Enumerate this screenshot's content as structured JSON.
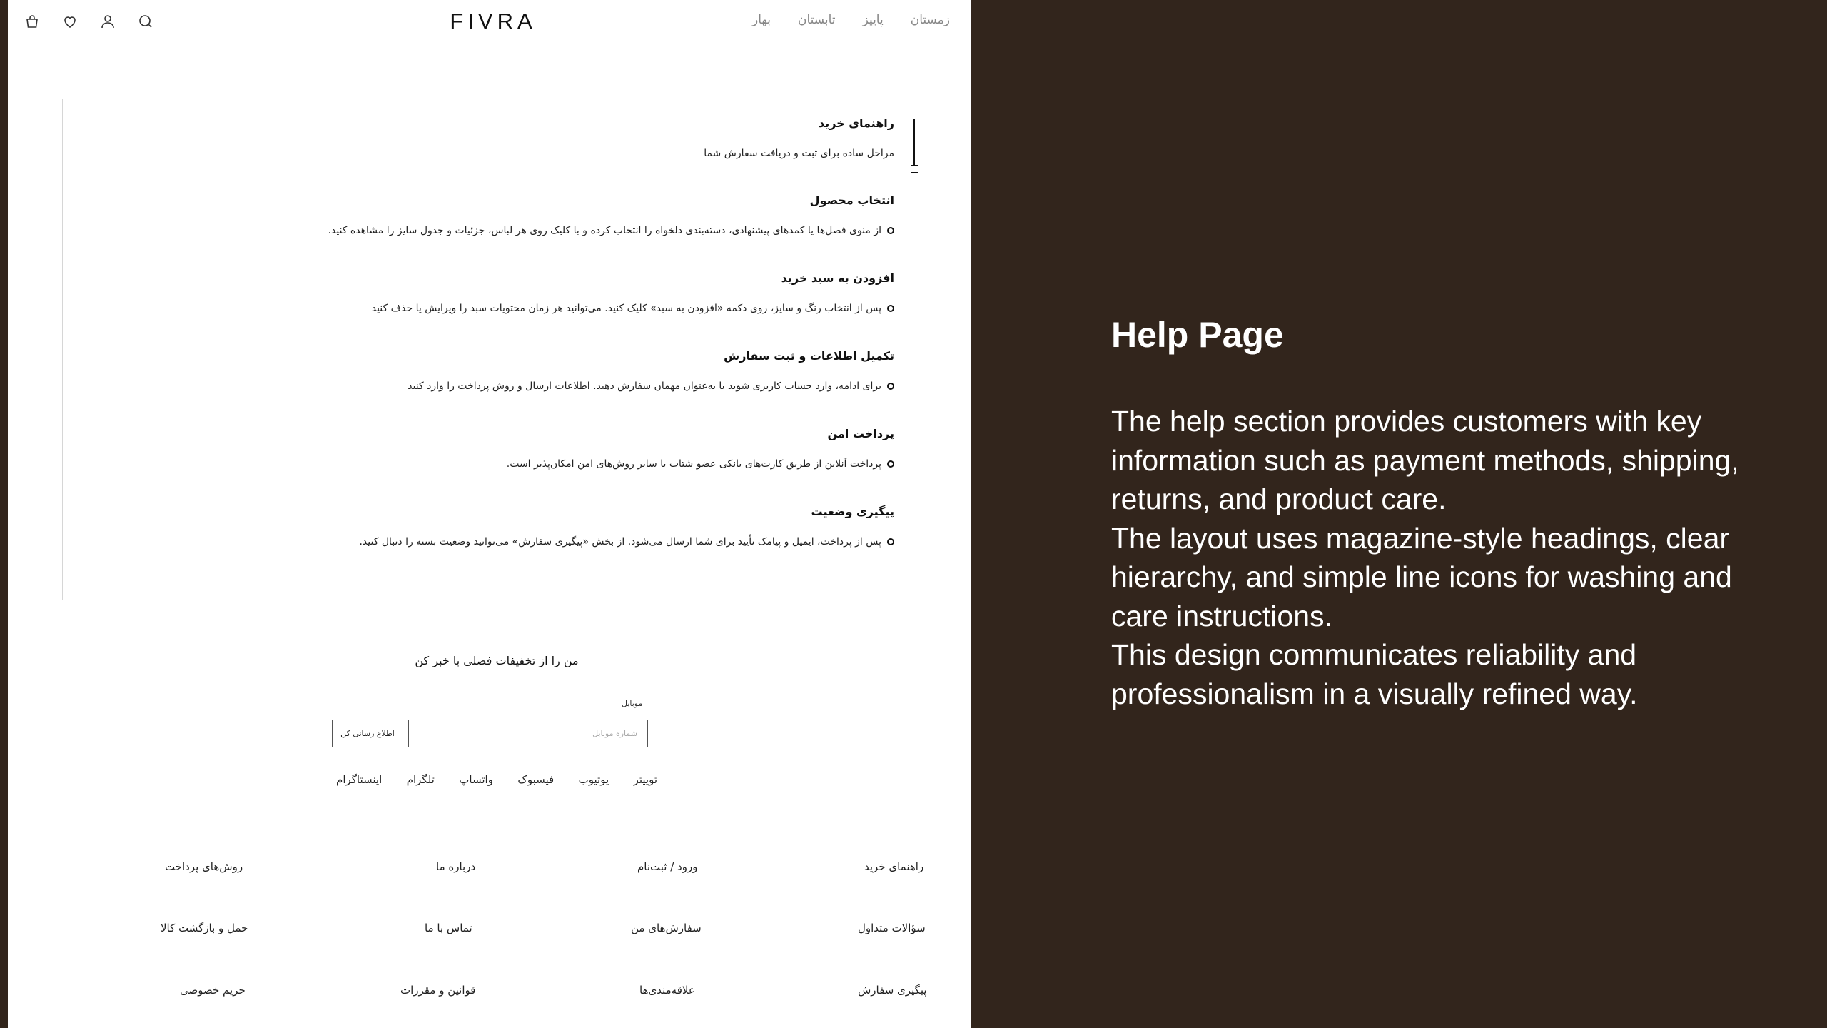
{
  "header": {
    "logo": "FIVRA",
    "nav": [
      "بهار",
      "تابستان",
      "پاییز",
      "زمستان"
    ],
    "icons": [
      "search-icon",
      "user-icon",
      "heart-icon",
      "bag-icon"
    ]
  },
  "guide": {
    "title": "راهنمای خرید",
    "subtitle": "مراحل ساده برای ثبت و دریافت سفارش شما",
    "steps": [
      {
        "title": "انتخاب محصول",
        "text": "از منوی فصل‌ها یا کمدهای پیشنهادی، دسته‌بندی دلخواه را انتخاب کرده و با کلیک روی هر لباس، جزئیات و جدول سایز را مشاهده کنید."
      },
      {
        "title": "افزودن به سبد خرید",
        "text": "پس از انتخاب رنگ و سایز، روی دکمه «افزودن به سبد» کلیک کنید. می‌توانید هر زمان محتویات سبد را ویرایش یا حذف کنید"
      },
      {
        "title": "تکمیل اطلاعات و ثبت سفارش",
        "text": "برای ادامه، وارد حساب کاربری شوید یا به‌عنوان مهمان سفارش دهید. اطلاعات ارسال و روش پرداخت را وارد کنید"
      },
      {
        "title": "پرداخت امن",
        "text": "پرداخت آنلاین از طریق کارت‌های بانکی عضو شتاب یا سایر روش‌های امن امکان‌پذیر است."
      },
      {
        "title": "پیگیری وضعیت",
        "text": "پس از پرداخت، ایمیل و پیامک تأیید برای شما ارسال می‌شود. از بخش «پیگیری سفارش» می‌توانید وضعیت بسته را دنبال کنید."
      }
    ]
  },
  "newsletter": {
    "title": "من را از تخفیفات فصلی با خبر کن",
    "field_label": "موبایل",
    "placeholder": "شماره موبایل",
    "button": "اطلاع رسانی کن"
  },
  "social": [
    "اینستاگرام",
    "تلگرام",
    "واتساپ",
    "فیسبوک",
    "یوتیوب",
    "توییتر"
  ],
  "footer": {
    "col1": [
      "راهنمای خرید",
      "سؤالات متداول",
      "پیگیری سفارش"
    ],
    "col2": [
      "ورود / ثبت‌نام",
      "سفارش‌های من",
      "علاقه‌مندی‌ها"
    ],
    "col3": [
      "درباره ما",
      "تماس با ما",
      "قوانین و مقررات"
    ],
    "col4": [
      "روش‌های پرداخت",
      "حمل و بازگشت کالا",
      "حریم خصوصی"
    ]
  },
  "panel": {
    "title": "Help Page",
    "paragraphs": [
      "The help section provides customers with key information such as payment methods, shipping, returns, and product care.",
      "The layout uses magazine-style headings, clear hierarchy, and simple line icons for washing and care instructions.",
      "This design communicates reliability and professionalism in a visually refined way."
    ]
  },
  "colors": {
    "panel_bg": "#32251c",
    "page_bg": "#ffffff",
    "text": "#1a1a1a"
  }
}
